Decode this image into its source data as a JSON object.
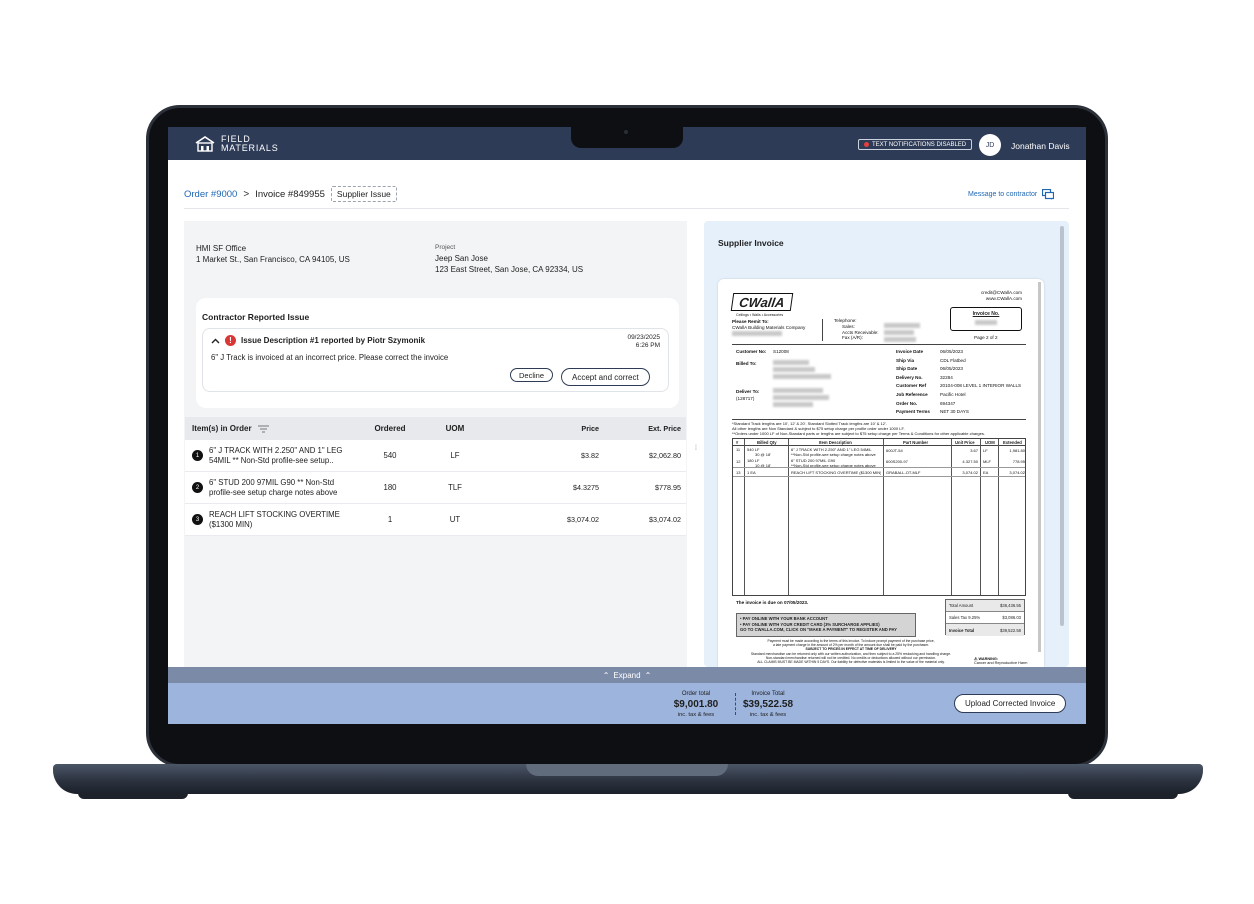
{
  "app": {
    "logo_line1": "FIELD",
    "logo_line2": "MATERIALS",
    "notification_status": "TEXT NOTIFICATIONS DISABLED",
    "user_initials": "JD",
    "user_name": "Jonathan Davis"
  },
  "breadcrumb": {
    "order": "Order #9000",
    "separator": ">",
    "invoice": "Invoice #849955",
    "badge": "Supplier Issue"
  },
  "message_contractor": "Message to contractor",
  "addresses": {
    "from_name": "HMI SF Office",
    "from_street": "1 Market St., San Francisco, CA 94105, US",
    "project_label": "Project",
    "project_name": "Jeep San Jose",
    "project_street": "123 East Street, San Jose, CA 92334, US"
  },
  "issue": {
    "section_title": "Contractor Reported Issue",
    "heading": "Issue Description #1 reported by Piotr Szymonik",
    "date": "09/23/2025",
    "time": "6:26 PM",
    "text": "6\" J Track is invoiced at an incorrect price. Please correct the invoice",
    "decline_label": "Decline",
    "accept_label": "Accept and correct"
  },
  "items_table": {
    "headers": [
      "Item(s) in Order",
      "Ordered",
      "UOM",
      "Price",
      "Ext. Price"
    ],
    "rows": [
      {
        "num": "1",
        "desc1": "6\" J TRACK WITH 2.250\" AND 1\" LEG",
        "desc2": "54MIL ** Non-Std profile-see setup..",
        "ordered": "540",
        "uom": "LF",
        "price": "$3.82",
        "ext": "$2,062.80"
      },
      {
        "num": "2",
        "desc1": "6\" STUD 200 97MIL G90 ** Non-Std",
        "desc2": "profile-see setup charge notes above",
        "ordered": "180",
        "uom": "TLF",
        "price": "$4.3275",
        "ext": "$778.95"
      },
      {
        "num": "3",
        "desc1": "REACH LIFT STOCKING OVERTIME",
        "desc2": "($1300 MIN)",
        "ordered": "1",
        "uom": "UT",
        "price": "$3,074.02",
        "ext": "$3,074.02"
      }
    ]
  },
  "supplier_invoice": {
    "title": "Supplier Invoice",
    "logo": "CWallA",
    "logo_tagline": "Ceilings • Walls • Accessories",
    "remit_label": "Please Remit To:",
    "remit_name": "CWallA Building Materials Company",
    "telephone_label": "Telephone:",
    "sales_label": "Sales:",
    "ar_label": "Accts Receivable:",
    "fax_label": "Fax (A/R):",
    "email": "credit@CWallA.com",
    "website": "www.CWallA.com",
    "invoice_no_label": "Invoice No.",
    "page_label": "Page 2 of 2",
    "customer_no_label": "Customer No:",
    "customer_no": "S12008",
    "billed_to_label": "Billed To:",
    "deliver_to_label": "Deliver To:",
    "deliver_code": "(128717)",
    "meta": [
      {
        "label": "Invoice Date",
        "value": "06/05/2023"
      },
      {
        "label": "Ship Via",
        "value": "CDL Flatbed"
      },
      {
        "label": "Ship Date",
        "value": "06/05/2023"
      },
      {
        "label": "Delivery No.",
        "value": "32284"
      },
      {
        "label": "Customer Ref",
        "value": "20104-008 LEVEL 1 INTERIOR WALLS"
      },
      {
        "label": "Job Reference",
        "value": "Pacific Hotel"
      },
      {
        "label": "Order No.",
        "value": "694347"
      },
      {
        "label": "Payment Terms",
        "value": "NET 30 DAYS"
      }
    ],
    "notes": [
      "*Standard Track lengths are 10', 12' & 20'. Standard Slotted Track lengths are 10' & 12'.",
      "All other lengths are Non Standard & subject to $75 setup charge per profile order under 1000 LF.",
      "**Orders under 1000 LF of Non-Standard parts or lengths are subject to $75 setup charge per Terms & Conditions for other applicable charges."
    ],
    "table_headers": [
      "#",
      "Billed Qty",
      "Item Description",
      "Part Number",
      "Unit Price",
      "UOM",
      "Extended"
    ],
    "table_rows": [
      {
        "n": "11",
        "qty": "540 LF",
        "qty2": "30 @ 18'",
        "desc": "6\" J TRACK WITH 2.250\" AND 1\" LEG 54MIL",
        "desc2": "**Non-Std profile-see setup charge notes above",
        "part": "600JT-54",
        "unit": "3.67",
        "uom": "LF",
        "ext": "1,981.80"
      },
      {
        "n": "12",
        "qty": "180 LF",
        "qty2": "10 @ 18'",
        "desc": "6\" STUD 200 97MIL G90",
        "desc2": "**Non-Std profile-see setup charge notes above",
        "part": "600S200-97",
        "unit": "4.327.50",
        "uom": "MLF",
        "ext": "778.95"
      },
      {
        "n": "13",
        "qty": "1 EA",
        "qty2": "",
        "desc": "REACH LIFT STOCKING OVERTIME ($1300 MIN)",
        "desc2": "",
        "part": "GRABALL-OT-MLF",
        "unit": "3,074.02",
        "uom": "EA",
        "ext": "3,074.02"
      }
    ],
    "due_text": "The invoice is due on 07/05/2023.",
    "pay_lines": [
      "• PAY ONLINE WITH YOUR BANK ACCOUNT",
      "• PAY ONLINE WITH YOUR CREDIT CARD (3% SURCHARGE APPLIES)",
      "GO TO CWALLA.COM, CLICK ON \"MAKE A PAYMENT\" TO REGISTER AND PAY"
    ],
    "totals": [
      {
        "label": "Total Amount",
        "value": "$36,436.55"
      },
      {
        "label": "Sales Tax 9.25%",
        "value": "$3,086.03"
      },
      {
        "label": "Invoice Total",
        "value": "$39,522.58"
      }
    ],
    "footer_lines": [
      "Payment must be made according to the terms of this invoice. To induce prompt payment of the purchase price,",
      "a late payment charge in the amount of 2% per month of the amount due shall be paid by the purchaser.",
      "SUBJECT TO PRICES IN EFFECT AT TIME OF DELIVERY",
      "Standard merchandise can be returned only with our written authorization, and then subject to a 25% restocking and handling charge.",
      "Non-standard merchandise returned will not be credited. No credits or deductions allowed without our permission.",
      "ALL CLAIMS MUST BE MADE WITHIN 5 DAYS. Our liability for defective materials is limited to the value of the material only."
    ],
    "warning_line1": "WARNING:",
    "warning_line2": "Cancer and Reproductive Harm"
  },
  "footer": {
    "expand_label": "Expand",
    "order_total_label": "Order total",
    "order_total": "$9,001.80",
    "order_total_sub": "inc. tax & fees",
    "invoice_total_label": "Invoice Total",
    "invoice_total": "$39,522.58",
    "invoice_total_sub": "inc. tax & fees",
    "upload_label": "Upload Corrected Invoice"
  },
  "colors": {
    "topbar": "#2e3b56",
    "link": "#1f67b3",
    "expand_bar": "#7b8ba7",
    "total_bar": "#9db4dc",
    "alert": "#d93636",
    "right_panel": "#e6f0fb"
  },
  "icons": [
    "building-icon",
    "notification-dot-icon",
    "chat-icon",
    "chevron-right-icon",
    "chevron-up-icon",
    "alert-icon",
    "filter-icon",
    "expand-chevron-icon",
    "warning-icon"
  ]
}
